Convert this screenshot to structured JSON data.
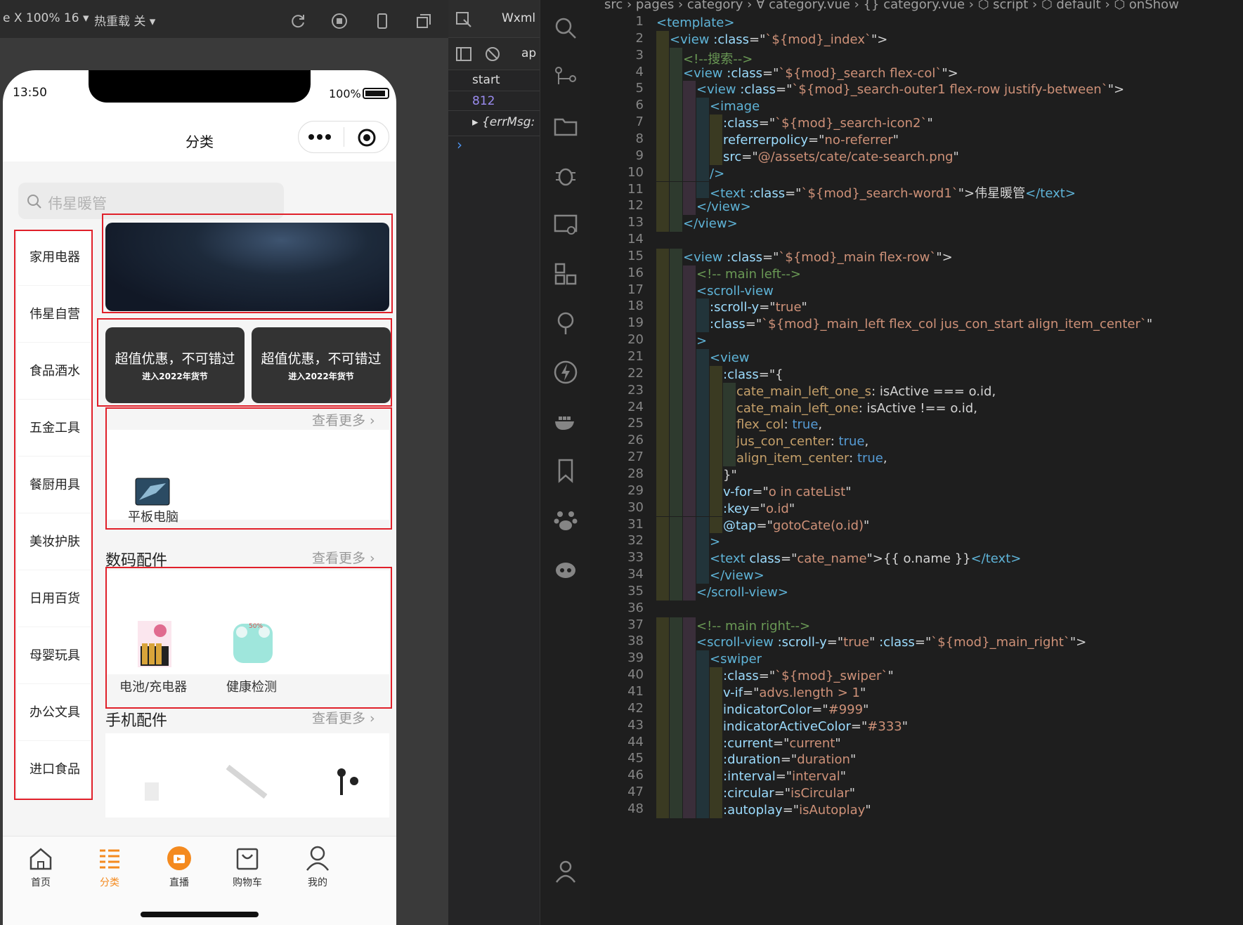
{
  "simulator": {
    "device_label": "e X 100% 16 ▾",
    "hot_reload": "热重载 关 ▾",
    "status_time": "13:50",
    "battery": "100%",
    "page_title": "分类",
    "search_placeholder": "伟星暖管",
    "categories": [
      "家用电器",
      "伟星自营",
      "食品酒水",
      "五金工具",
      "餐厨用具",
      "美妆护肤",
      "日用百货",
      "母婴玩具",
      "办公文具",
      "进口食品"
    ],
    "promos": [
      {
        "title": "超值优惠，不可错过",
        "subtitle": "进入2022年货节"
      },
      {
        "title": "超值优惠，不可错过",
        "subtitle": "进入2022年货节"
      }
    ],
    "see_more": "查看更多",
    "section1_products": [
      "平板电脑"
    ],
    "section2_title": "数码配件",
    "section2_products": [
      "电池/充电器",
      "健康检测"
    ],
    "section3_title": "手机配件",
    "tabbar": [
      "首页",
      "分类",
      "直播",
      "购物车",
      "我的"
    ],
    "active_tab": "分类",
    "accent_color": "#f48a1f",
    "highlight_color": "#e0202a"
  },
  "devtools": {
    "tab": "Wxml",
    "tab2": "ap",
    "log_start": "start",
    "log_number": "812",
    "log_err": "▸ {errMsg:",
    "prompt": "›"
  },
  "editor": {
    "breadcrumb": "src › pages › category › ∀ category.vue › {} category.vue › ⬡ script › ⬡ default › ⬡ onShow",
    "lines": [
      [
        {
          "c": "tag",
          "t": "<template>"
        }
      ],
      [
        {
          "c": "tag",
          "t": "<view "
        },
        {
          "c": "attr",
          "t": ":class"
        },
        {
          "c": "plain",
          "t": "=\""
        },
        {
          "c": "str",
          "t": "`${mod}_index`"
        },
        {
          "c": "plain",
          "t": "\">"
        }
      ],
      [
        {
          "c": "com",
          "t": "<!--搜索-->"
        }
      ],
      [
        {
          "c": "tag",
          "t": "<view "
        },
        {
          "c": "attr",
          "t": ":class"
        },
        {
          "c": "plain",
          "t": "=\""
        },
        {
          "c": "str",
          "t": "`${mod}_search flex-col`"
        },
        {
          "c": "plain",
          "t": "\">"
        }
      ],
      [
        {
          "c": "tag",
          "t": "<view "
        },
        {
          "c": "attr",
          "t": ":class"
        },
        {
          "c": "plain",
          "t": "=\""
        },
        {
          "c": "str",
          "t": "`${mod}_search-outer1 flex-row justify-between`"
        },
        {
          "c": "plain",
          "t": "\">"
        }
      ],
      [
        {
          "c": "tag",
          "t": "<image"
        }
      ],
      [
        {
          "c": "attr",
          "t": ":class"
        },
        {
          "c": "plain",
          "t": "=\""
        },
        {
          "c": "str",
          "t": "`${mod}_search-icon2`"
        },
        {
          "c": "plain",
          "t": "\""
        }
      ],
      [
        {
          "c": "attr",
          "t": "referrerpolicy"
        },
        {
          "c": "plain",
          "t": "=\""
        },
        {
          "c": "str",
          "t": "no-referrer"
        },
        {
          "c": "plain",
          "t": "\""
        }
      ],
      [
        {
          "c": "attr",
          "t": "src"
        },
        {
          "c": "plain",
          "t": "=\""
        },
        {
          "c": "str",
          "t": "@/assets/cate/cate-search.png"
        },
        {
          "c": "plain",
          "t": "\""
        }
      ],
      [
        {
          "c": "tag",
          "t": "/>"
        }
      ],
      [
        {
          "c": "tag",
          "t": "<text "
        },
        {
          "c": "attr",
          "t": ":class"
        },
        {
          "c": "plain",
          "t": "=\""
        },
        {
          "c": "str",
          "t": "`${mod}_search-word1`"
        },
        {
          "c": "plain",
          "t": "\">伟星暖管"
        },
        {
          "c": "tag",
          "t": "</text>"
        }
      ],
      [
        {
          "c": "tag",
          "t": "</view>"
        }
      ],
      [
        {
          "c": "tag",
          "t": "</view>"
        }
      ],
      [
        {
          "c": "plain",
          "t": ""
        }
      ],
      [
        {
          "c": "tag",
          "t": "<view "
        },
        {
          "c": "attr",
          "t": ":class"
        },
        {
          "c": "plain",
          "t": "=\""
        },
        {
          "c": "str",
          "t": "`${mod}_main flex-row`"
        },
        {
          "c": "plain",
          "t": "\">"
        }
      ],
      [
        {
          "c": "com",
          "t": "<!-- main left-->"
        }
      ],
      [
        {
          "c": "tag",
          "t": "<scroll-view"
        }
      ],
      [
        {
          "c": "attr",
          "t": ":scroll-y"
        },
        {
          "c": "plain",
          "t": "=\""
        },
        {
          "c": "str",
          "t": "true"
        },
        {
          "c": "plain",
          "t": "\""
        }
      ],
      [
        {
          "c": "attr",
          "t": ":class"
        },
        {
          "c": "plain",
          "t": "=\""
        },
        {
          "c": "str",
          "t": "`${mod}_main_left flex_col jus_con_start align_item_center`"
        },
        {
          "c": "plain",
          "t": "\""
        }
      ],
      [
        {
          "c": "tag",
          "t": ">"
        }
      ],
      [
        {
          "c": "tag",
          "t": "<view"
        }
      ],
      [
        {
          "c": "attr",
          "t": ":class"
        },
        {
          "c": "plain",
          "t": "=\"{"
        }
      ],
      [
        {
          "c": "prop",
          "t": "cate_main_left_one_s"
        },
        {
          "c": "plain",
          "t": ": isActive === o.id,"
        }
      ],
      [
        {
          "c": "prop",
          "t": "cate_main_left_one"
        },
        {
          "c": "plain",
          "t": ": isActive !== o.id,"
        }
      ],
      [
        {
          "c": "prop",
          "t": "flex_col"
        },
        {
          "c": "plain",
          "t": ": "
        },
        {
          "c": "kw",
          "t": "true"
        },
        {
          "c": "plain",
          "t": ","
        }
      ],
      [
        {
          "c": "prop",
          "t": "jus_con_center"
        },
        {
          "c": "plain",
          "t": ": "
        },
        {
          "c": "kw",
          "t": "true"
        },
        {
          "c": "plain",
          "t": ","
        }
      ],
      [
        {
          "c": "prop",
          "t": "align_item_center"
        },
        {
          "c": "plain",
          "t": ": "
        },
        {
          "c": "kw",
          "t": "true"
        },
        {
          "c": "plain",
          "t": ","
        }
      ],
      [
        {
          "c": "plain",
          "t": "}\""
        }
      ],
      [
        {
          "c": "attr",
          "t": "v-for"
        },
        {
          "c": "plain",
          "t": "=\""
        },
        {
          "c": "str",
          "t": "o in cateList"
        },
        {
          "c": "plain",
          "t": "\""
        }
      ],
      [
        {
          "c": "attr",
          "t": ":key"
        },
        {
          "c": "plain",
          "t": "=\""
        },
        {
          "c": "str",
          "t": "o.id"
        },
        {
          "c": "plain",
          "t": "\""
        }
      ],
      [
        {
          "c": "attr",
          "t": "@tap"
        },
        {
          "c": "plain",
          "t": "=\""
        },
        {
          "c": "str",
          "t": "gotoCate(o.id)"
        },
        {
          "c": "plain",
          "t": "\""
        }
      ],
      [
        {
          "c": "tag",
          "t": ">"
        }
      ],
      [
        {
          "c": "tag",
          "t": "<text "
        },
        {
          "c": "attr",
          "t": "class"
        },
        {
          "c": "plain",
          "t": "=\""
        },
        {
          "c": "str",
          "t": "cate_name"
        },
        {
          "c": "plain",
          "t": "\">{{ o.name }}"
        },
        {
          "c": "tag",
          "t": "</text>"
        }
      ],
      [
        {
          "c": "tag",
          "t": "</view>"
        }
      ],
      [
        {
          "c": "tag",
          "t": "</scroll-view>"
        }
      ],
      [
        {
          "c": "plain",
          "t": ""
        }
      ],
      [
        {
          "c": "com",
          "t": "<!-- main right-->"
        }
      ],
      [
        {
          "c": "tag",
          "t": "<scroll-view "
        },
        {
          "c": "attr",
          "t": ":scroll-y"
        },
        {
          "c": "plain",
          "t": "=\""
        },
        {
          "c": "str",
          "t": "true"
        },
        {
          "c": "plain",
          "t": "\" "
        },
        {
          "c": "attr",
          "t": ":class"
        },
        {
          "c": "plain",
          "t": "=\""
        },
        {
          "c": "str",
          "t": "`${mod}_main_right`"
        },
        {
          "c": "plain",
          "t": "\">"
        }
      ],
      [
        {
          "c": "tag",
          "t": "<swiper"
        }
      ],
      [
        {
          "c": "attr",
          "t": ":class"
        },
        {
          "c": "plain",
          "t": "=\""
        },
        {
          "c": "str",
          "t": "`${mod}_swiper`"
        },
        {
          "c": "plain",
          "t": "\""
        }
      ],
      [
        {
          "c": "attr",
          "t": "v-if"
        },
        {
          "c": "plain",
          "t": "=\""
        },
        {
          "c": "str",
          "t": "advs.length > 1"
        },
        {
          "c": "plain",
          "t": "\""
        }
      ],
      [
        {
          "c": "attr",
          "t": "indicatorColor"
        },
        {
          "c": "plain",
          "t": "=\""
        },
        {
          "c": "str",
          "t": "#999"
        },
        {
          "c": "plain",
          "t": "\""
        }
      ],
      [
        {
          "c": "attr",
          "t": "indicatorActiveColor"
        },
        {
          "c": "plain",
          "t": "=\""
        },
        {
          "c": "str",
          "t": "#333"
        },
        {
          "c": "plain",
          "t": "\""
        }
      ],
      [
        {
          "c": "attr",
          "t": ":current"
        },
        {
          "c": "plain",
          "t": "=\""
        },
        {
          "c": "str",
          "t": "current"
        },
        {
          "c": "plain",
          "t": "\""
        }
      ],
      [
        {
          "c": "attr",
          "t": ":duration"
        },
        {
          "c": "plain",
          "t": "=\""
        },
        {
          "c": "str",
          "t": "duration"
        },
        {
          "c": "plain",
          "t": "\""
        }
      ],
      [
        {
          "c": "attr",
          "t": ":interval"
        },
        {
          "c": "plain",
          "t": "=\""
        },
        {
          "c": "str",
          "t": "interval"
        },
        {
          "c": "plain",
          "t": "\""
        }
      ],
      [
        {
          "c": "attr",
          "t": ":circular"
        },
        {
          "c": "plain",
          "t": "=\""
        },
        {
          "c": "str",
          "t": "isCircular"
        },
        {
          "c": "plain",
          "t": "\""
        }
      ],
      [
        {
          "c": "attr",
          "t": ":autoplay"
        },
        {
          "c": "plain",
          "t": "=\""
        },
        {
          "c": "str",
          "t": "isAutoplay"
        },
        {
          "c": "plain",
          "t": "\""
        }
      ]
    ]
  }
}
